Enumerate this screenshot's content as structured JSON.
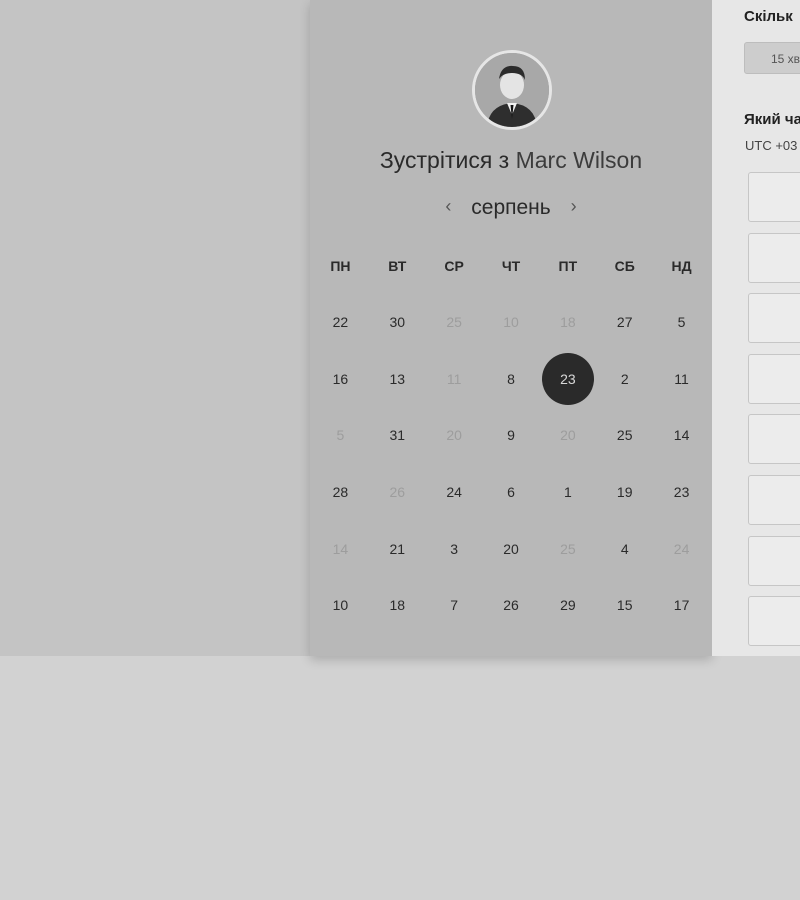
{
  "calendar": {
    "title_prefix": "Зустрітися з",
    "host_name": "Marc Wilson",
    "month": "серпень",
    "prev_arrow": "‹",
    "next_arrow": "›",
    "weekdays": [
      "ПН",
      "ВТ",
      "СР",
      "ЧТ",
      "ПТ",
      "СБ",
      "НД"
    ],
    "weeks": [
      [
        {
          "n": "22"
        },
        {
          "n": "30"
        },
        {
          "n": "25",
          "off": true
        },
        {
          "n": "10",
          "off": true
        },
        {
          "n": "18",
          "off": true
        },
        {
          "n": "27"
        },
        {
          "n": "5"
        }
      ],
      [
        {
          "n": "16"
        },
        {
          "n": "13"
        },
        {
          "n": "11",
          "off": true
        },
        {
          "n": "8"
        },
        {
          "n": "23",
          "selected": true
        },
        {
          "n": "2"
        },
        {
          "n": "11"
        }
      ],
      [
        {
          "n": "5",
          "off": true
        },
        {
          "n": "31"
        },
        {
          "n": "20",
          "off": true
        },
        {
          "n": "9"
        },
        {
          "n": "20",
          "off": true
        },
        {
          "n": "25"
        },
        {
          "n": "14"
        }
      ],
      [
        {
          "n": "28"
        },
        {
          "n": "26",
          "off": true
        },
        {
          "n": "24"
        },
        {
          "n": "6"
        },
        {
          "n": "1"
        },
        {
          "n": "19"
        },
        {
          "n": "23"
        }
      ],
      [
        {
          "n": "14",
          "off": true
        },
        {
          "n": "21"
        },
        {
          "n": "3"
        },
        {
          "n": "20"
        },
        {
          "n": "25",
          "off": true
        },
        {
          "n": "4"
        },
        {
          "n": "24",
          "off": true
        }
      ],
      [
        {
          "n": "10"
        },
        {
          "n": "18"
        },
        {
          "n": "7"
        },
        {
          "n": "26"
        },
        {
          "n": "29"
        },
        {
          "n": "15"
        },
        {
          "n": "17"
        }
      ]
    ]
  },
  "booking": {
    "duration_label": "Скільк",
    "duration_button": "15 хв",
    "time_label": "Який ча",
    "timezone": "UTC +03"
  },
  "colors": {
    "selected_day": "#2a2a2a",
    "panel": "#b8b8b8"
  }
}
